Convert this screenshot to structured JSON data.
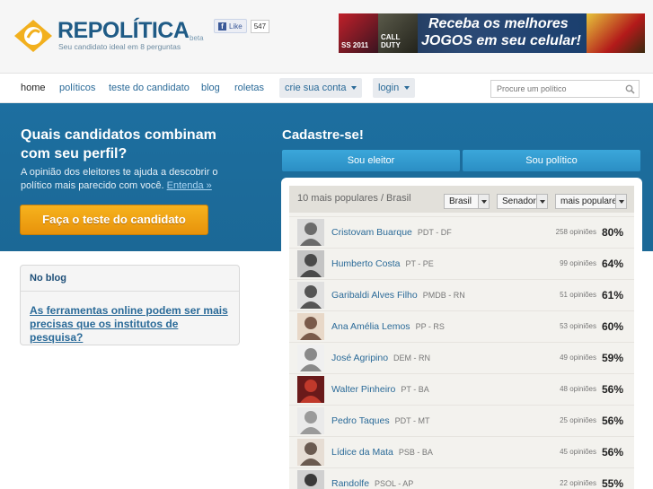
{
  "header": {
    "logo_text": "REPOLÍTICA",
    "logo_beta": "beta",
    "tagline": "Seu candidato ideal em 8 perguntas",
    "fb_like_label": "Like",
    "fb_like_count": "547",
    "ad": {
      "game1": "SS 2011",
      "game2": "CALL DUTY",
      "line1": "Receba os melhores",
      "line2": "JOGOS em seu celular!"
    }
  },
  "nav": {
    "links": [
      "home",
      "políticos",
      "teste do candidato",
      "blog",
      "roletas"
    ],
    "create_label": "crie sua conta",
    "login_label": "login",
    "search_placeholder": "Procure um político"
  },
  "hero": {
    "title_line1": "Quais candidatos combinam",
    "title_line2": "com seu perfil?",
    "description": "A opinião dos eleitores te ajuda a descobrir o político mais parecido com você.",
    "more_link": "Entenda »",
    "cta_label": "Faça o teste do candidato",
    "signup_title": "Cadastre-se!",
    "voter_button": "Sou eleitor",
    "politician_button": "Sou político"
  },
  "blog": {
    "title": "No blog",
    "link": "As ferramentas online podem ser mais precisas que os institutos de pesquisa?"
  },
  "popular": {
    "title": "10 mais populares / Brasil",
    "filters": {
      "region": "Brasil",
      "office": "Senador",
      "sort": "mais populare"
    },
    "rows": [
      {
        "name": "Cristovam Buarque",
        "party": "PDT - DF",
        "opinions": "258 opiniões",
        "pct": "80%"
      },
      {
        "name": "Humberto Costa",
        "party": "PT - PE",
        "opinions": "99 opiniões",
        "pct": "64%"
      },
      {
        "name": "Garibaldi Alves Filho",
        "party": "PMDB - RN",
        "opinions": "51 opiniões",
        "pct": "61%"
      },
      {
        "name": "Ana Amélia Lemos",
        "party": "PP - RS",
        "opinions": "53 opiniões",
        "pct": "60%"
      },
      {
        "name": "José Agripino",
        "party": "DEM - RN",
        "opinions": "49 opiniões",
        "pct": "59%"
      },
      {
        "name": "Walter Pinheiro",
        "party": "PT - BA",
        "opinions": "48 opiniões",
        "pct": "56%"
      },
      {
        "name": "Pedro Taques",
        "party": "PDT - MT",
        "opinions": "25 opiniões",
        "pct": "56%"
      },
      {
        "name": "Lídice da Mata",
        "party": "PSB - BA",
        "opinions": "45 opiniões",
        "pct": "56%"
      },
      {
        "name": "Randolfe",
        "party": "PSOL - AP",
        "opinions": "22 opiniões",
        "pct": "55%"
      }
    ]
  },
  "colors": {
    "brand_blue": "#1f5b86",
    "hero_blue": "#1d6fa0",
    "cta_orange": "#f0a317",
    "link_blue": "#2a6a98"
  }
}
